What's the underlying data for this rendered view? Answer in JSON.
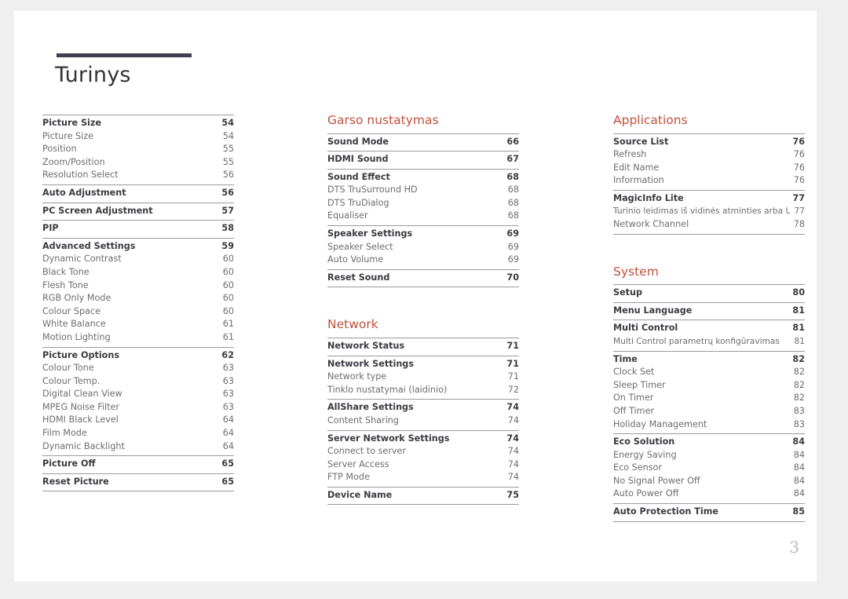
{
  "document": {
    "title": "Turinys",
    "page_number": "3",
    "accent_bar_color": "#40404f",
    "heading_color": "#c0513c",
    "rule_color": "#9b9b9b",
    "page_background": "#ffffff",
    "canvas_background": "#efefef"
  },
  "columns": [
    {
      "id": "column-1",
      "sections": [
        {
          "heading": null,
          "groups": [
            {
              "rows": [
                {
                  "label": "Picture Size",
                  "page": "54",
                  "level": "main"
                },
                {
                  "label": "Picture Size",
                  "page": "54",
                  "level": "sub"
                },
                {
                  "label": "Position",
                  "page": "55",
                  "level": "sub"
                },
                {
                  "label": "Zoom/Position",
                  "page": "55",
                  "level": "sub"
                },
                {
                  "label": "Resolution Select",
                  "page": "56",
                  "level": "sub"
                }
              ]
            },
            {
              "rows": [
                {
                  "label": "Auto Adjustment",
                  "page": "56",
                  "level": "main"
                }
              ]
            },
            {
              "rows": [
                {
                  "label": "PC Screen Adjustment",
                  "page": "57",
                  "level": "main"
                }
              ]
            },
            {
              "rows": [
                {
                  "label": "PIP",
                  "page": "58",
                  "level": "main"
                }
              ]
            },
            {
              "rows": [
                {
                  "label": "Advanced Settings",
                  "page": "59",
                  "level": "main"
                },
                {
                  "label": "Dynamic Contrast",
                  "page": "60",
                  "level": "sub"
                },
                {
                  "label": "Black Tone",
                  "page": "60",
                  "level": "sub"
                },
                {
                  "label": "Flesh Tone",
                  "page": "60",
                  "level": "sub"
                },
                {
                  "label": "RGB Only Mode",
                  "page": "60",
                  "level": "sub"
                },
                {
                  "label": "Colour Space",
                  "page": "60",
                  "level": "sub"
                },
                {
                  "label": "White Balance",
                  "page": "61",
                  "level": "sub"
                },
                {
                  "label": "Motion Lighting",
                  "page": "61",
                  "level": "sub"
                }
              ]
            },
            {
              "rows": [
                {
                  "label": "Picture Options",
                  "page": "62",
                  "level": "main"
                },
                {
                  "label": "Colour Tone",
                  "page": "63",
                  "level": "sub"
                },
                {
                  "label": "Colour Temp.",
                  "page": "63",
                  "level": "sub"
                },
                {
                  "label": "Digital Clean View",
                  "page": "63",
                  "level": "sub"
                },
                {
                  "label": "MPEG Noise Filter",
                  "page": "63",
                  "level": "sub"
                },
                {
                  "label": "HDMI Black Level",
                  "page": "64",
                  "level": "sub"
                },
                {
                  "label": "Film Mode",
                  "page": "64",
                  "level": "sub"
                },
                {
                  "label": "Dynamic Backlight",
                  "page": "64",
                  "level": "sub"
                }
              ]
            },
            {
              "rows": [
                {
                  "label": "Picture Off",
                  "page": "65",
                  "level": "main"
                }
              ]
            },
            {
              "last": true,
              "rows": [
                {
                  "label": "Reset Picture",
                  "page": "65",
                  "level": "main"
                }
              ]
            }
          ]
        }
      ]
    },
    {
      "id": "column-2",
      "sections": [
        {
          "heading": "Garso nustatymas",
          "groups": [
            {
              "rows": [
                {
                  "label": "Sound Mode",
                  "page": "66",
                  "level": "main"
                }
              ]
            },
            {
              "rows": [
                {
                  "label": "HDMI Sound",
                  "page": "67",
                  "level": "main"
                }
              ]
            },
            {
              "rows": [
                {
                  "label": "Sound Effect",
                  "page": "68",
                  "level": "main"
                },
                {
                  "label": "DTS TruSurround HD",
                  "page": "68",
                  "level": "sub"
                },
                {
                  "label": "DTS TruDialog",
                  "page": "68",
                  "level": "sub"
                },
                {
                  "label": "Equaliser",
                  "page": "68",
                  "level": "sub"
                }
              ]
            },
            {
              "rows": [
                {
                  "label": "Speaker Settings",
                  "page": "69",
                  "level": "main"
                },
                {
                  "label": "Speaker Select",
                  "page": "69",
                  "level": "sub"
                },
                {
                  "label": "Auto Volume",
                  "page": "69",
                  "level": "sub"
                }
              ]
            },
            {
              "last": true,
              "rows": [
                {
                  "label": "Reset Sound",
                  "page": "70",
                  "level": "main"
                }
              ]
            }
          ]
        },
        {
          "heading": "Network",
          "groups": [
            {
              "rows": [
                {
                  "label": "Network Status",
                  "page": "71",
                  "level": "main"
                }
              ]
            },
            {
              "rows": [
                {
                  "label": "Network Settings",
                  "page": "71",
                  "level": "main"
                },
                {
                  "label": "Network type",
                  "page": "71",
                  "level": "sub"
                },
                {
                  "label": "Tinklo nustatymai (laidinio)",
                  "page": "72",
                  "level": "sub"
                }
              ]
            },
            {
              "rows": [
                {
                  "label": "AllShare Settings",
                  "page": "74",
                  "level": "main"
                },
                {
                  "label": "Content Sharing",
                  "page": "74",
                  "level": "sub"
                }
              ]
            },
            {
              "rows": [
                {
                  "label": "Server Network Settings",
                  "page": "74",
                  "level": "main"
                },
                {
                  "label": "Connect to server",
                  "page": "74",
                  "level": "sub"
                },
                {
                  "label": "Server Access",
                  "page": "74",
                  "level": "sub"
                },
                {
                  "label": "FTP Mode",
                  "page": "74",
                  "level": "sub"
                }
              ]
            },
            {
              "last": true,
              "rows": [
                {
                  "label": "Device Name",
                  "page": "75",
                  "level": "main"
                }
              ]
            }
          ]
        }
      ]
    },
    {
      "id": "column-3",
      "sections": [
        {
          "heading": "Applications",
          "groups": [
            {
              "rows": [
                {
                  "label": "Source List",
                  "page": "76",
                  "level": "main"
                },
                {
                  "label": "Refresh",
                  "page": "76",
                  "level": "sub"
                },
                {
                  "label": "Edit Name",
                  "page": "76",
                  "level": "sub"
                },
                {
                  "label": "Information",
                  "page": "76",
                  "level": "sub"
                }
              ]
            },
            {
              "last": true,
              "rows": [
                {
                  "label": "MagicInfo Lite",
                  "page": "77",
                  "level": "main"
                },
                {
                  "label": "Turinio leidimas iš vidinės atminties arba USB",
                  "page": "77",
                  "level": "sub",
                  "tight": true
                },
                {
                  "label": "Network Channel",
                  "page": "78",
                  "level": "sub"
                }
              ]
            }
          ]
        },
        {
          "heading": "System",
          "groups": [
            {
              "rows": [
                {
                  "label": "Setup",
                  "page": "80",
                  "level": "main"
                }
              ]
            },
            {
              "rows": [
                {
                  "label": "Menu Language",
                  "page": "81",
                  "level": "main"
                }
              ]
            },
            {
              "rows": [
                {
                  "label": "Multi Control",
                  "page": "81",
                  "level": "main"
                },
                {
                  "label": "Multi Control parametrų konfigūravimas",
                  "page": "81",
                  "level": "sub",
                  "tight": true
                }
              ]
            },
            {
              "rows": [
                {
                  "label": "Time",
                  "page": "82",
                  "level": "main"
                },
                {
                  "label": "Clock Set",
                  "page": "82",
                  "level": "sub"
                },
                {
                  "label": "Sleep Timer",
                  "page": "82",
                  "level": "sub"
                },
                {
                  "label": "On Timer",
                  "page": "82",
                  "level": "sub"
                },
                {
                  "label": "Off Timer",
                  "page": "83",
                  "level": "sub"
                },
                {
                  "label": "Holiday Management",
                  "page": "83",
                  "level": "sub"
                }
              ]
            },
            {
              "rows": [
                {
                  "label": "Eco Solution",
                  "page": "84",
                  "level": "main"
                },
                {
                  "label": "Energy Saving",
                  "page": "84",
                  "level": "sub"
                },
                {
                  "label": "Eco Sensor",
                  "page": "84",
                  "level": "sub"
                },
                {
                  "label": "No Signal Power Off",
                  "page": "84",
                  "level": "sub"
                },
                {
                  "label": "Auto Power Off",
                  "page": "84",
                  "level": "sub"
                }
              ]
            },
            {
              "last": true,
              "rows": [
                {
                  "label": "Auto Protection Time",
                  "page": "85",
                  "level": "main"
                }
              ]
            }
          ]
        }
      ]
    }
  ]
}
